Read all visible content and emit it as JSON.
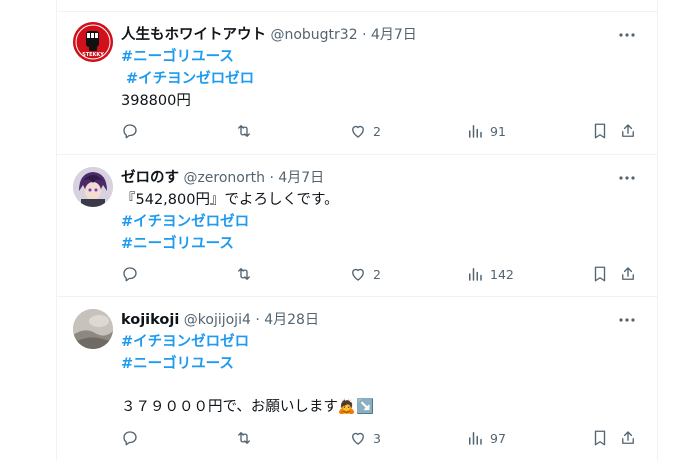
{
  "tweets": [
    {
      "display_name": "人生もホワイトアウト",
      "handle": "@nobugtr32",
      "date": "4月7日",
      "lines": [
        "#ニーゴリユース",
        "#イチヨンゼロゼロ",
        "398800円"
      ],
      "replies": "",
      "retweets": "",
      "likes": "2",
      "views": "91",
      "avatar_icon": "fist-logo-avatar",
      "avatar_label": "STEKKY"
    },
    {
      "display_name": "ゼロのす",
      "handle": "@zeronorth",
      "date": "4月7日",
      "lines": [
        "『542,800円』でよろしくです。",
        "#イチヨンゼロゼロ",
        "#ニーゴリユース"
      ],
      "replies": "",
      "retweets": "",
      "likes": "2",
      "views": "142",
      "avatar_icon": "anime-character-avatar"
    },
    {
      "display_name": "kojikoji",
      "handle": "@kojijoji4",
      "date": "4月28日",
      "lines": [
        "#イチヨンゼロゼロ",
        "#ニーゴリユース",
        "",
        "３７９０００円で、お願いします🙇↘️"
      ],
      "replies": "",
      "retweets": "",
      "likes": "3",
      "views": "97",
      "avatar_icon": "photo-avatar"
    }
  ],
  "separator": "·",
  "colors": {
    "hashtag": "#1d9bf0",
    "secondary_text": "#536471",
    "border": "#eff3f4"
  }
}
